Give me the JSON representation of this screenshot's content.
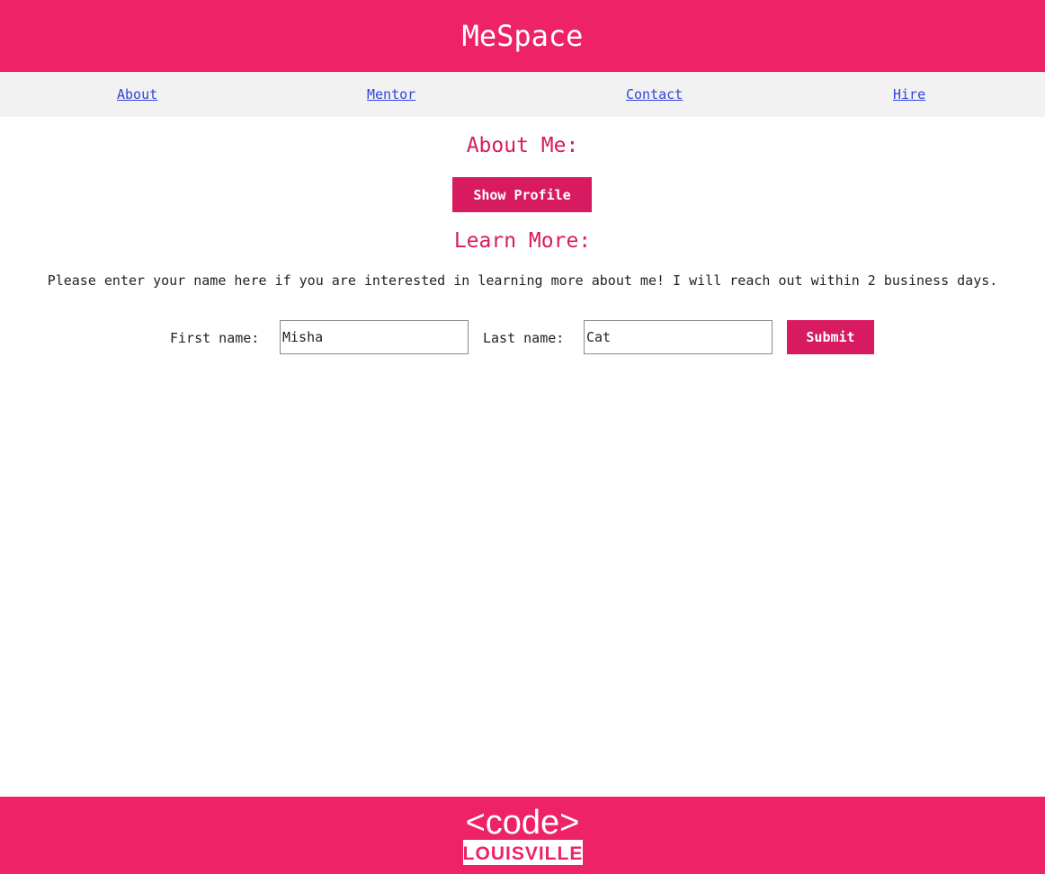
{
  "header": {
    "title": "MeSpace"
  },
  "nav": {
    "items": [
      {
        "label": "About"
      },
      {
        "label": "Mentor"
      },
      {
        "label": "Contact"
      },
      {
        "label": "Hire"
      }
    ]
  },
  "about": {
    "heading": "About Me:",
    "show_profile_label": "Show Profile"
  },
  "learn": {
    "heading": "Learn More:",
    "intro": "Please enter your name here if you are interested in learning more about me! I will reach out within 2 business days."
  },
  "form": {
    "first_name_label": "First name:",
    "first_name_value": "Misha",
    "last_name_label": "Last name:",
    "last_name_value": "Cat",
    "submit_label": "Submit"
  },
  "footer": {
    "logo_top": "<code>",
    "logo_bottom": "LOUISVILLE"
  },
  "colors": {
    "brand": "#ee2266",
    "accent": "#d81b60",
    "nav_bg": "#f2f2f2",
    "link": "#3344dd"
  }
}
